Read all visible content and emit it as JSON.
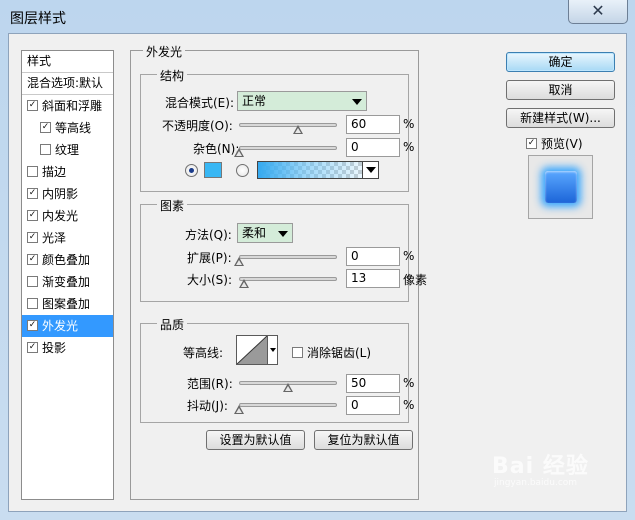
{
  "window": {
    "title": "图层样式",
    "close_glyph": "✕"
  },
  "style_list": {
    "header": "样式",
    "blending": "混合选项:默认",
    "items": [
      {
        "label": "斜面和浮雕",
        "checked": true,
        "indent": false
      },
      {
        "label": "等高线",
        "checked": true,
        "indent": true
      },
      {
        "label": "纹理",
        "checked": false,
        "indent": true
      },
      {
        "label": "描边",
        "checked": false,
        "indent": false
      },
      {
        "label": "内阴影",
        "checked": true,
        "indent": false
      },
      {
        "label": "内发光",
        "checked": true,
        "indent": false
      },
      {
        "label": "光泽",
        "checked": true,
        "indent": false
      },
      {
        "label": "颜色叠加",
        "checked": true,
        "indent": false
      },
      {
        "label": "渐变叠加",
        "checked": false,
        "indent": false
      },
      {
        "label": "图案叠加",
        "checked": false,
        "indent": false
      },
      {
        "label": "外发光",
        "checked": true,
        "indent": false,
        "selected": true
      },
      {
        "label": "投影",
        "checked": true,
        "indent": false
      }
    ]
  },
  "panel": {
    "title": "外发光",
    "structure": {
      "title": "结构",
      "blend_mode_label": "混合模式(E):",
      "blend_mode_value": "正常",
      "opacity_label": "不透明度(O):",
      "opacity_value": "60",
      "noise_label": "杂色(N):",
      "noise_value": "0",
      "unit": "%",
      "color_hex": "#38b7f4"
    },
    "elements": {
      "title": "图素",
      "technique_label": "方法(Q):",
      "technique_value": "柔和",
      "spread_label": "扩展(P):",
      "spread_value": "0",
      "spread_unit": "%",
      "size_label": "大小(S):",
      "size_value": "13",
      "size_unit": "像素"
    },
    "quality": {
      "title": "品质",
      "contour_label": "等高线:",
      "antialias_label": "消除锯齿(L)",
      "antialias_checked": false,
      "range_label": "范围(R):",
      "range_value": "50",
      "range_unit": "%",
      "jitter_label": "抖动(J):",
      "jitter_value": "0",
      "jitter_unit": "%"
    },
    "make_default": "设置为默认值",
    "reset_default": "复位为默认值"
  },
  "buttons": {
    "ok": "确定",
    "cancel": "取消",
    "new_style": "新建样式(W)...",
    "preview_label": "预览(V)",
    "preview_checked": true
  },
  "watermark": {
    "brand": "Bai 经验",
    "url": "jingyan.baidu.com"
  }
}
